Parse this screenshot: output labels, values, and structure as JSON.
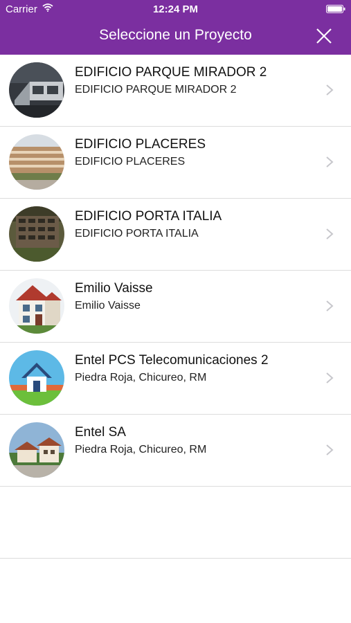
{
  "status_bar": {
    "carrier": "Carrier",
    "time": "12:24 PM"
  },
  "header": {
    "title": "Seleccione un Proyecto"
  },
  "icons": {
    "wifi": "wifi-icon",
    "battery": "battery-icon",
    "close": "close-icon",
    "chevron": "chevron-right-icon"
  },
  "colors": {
    "header_bg": "#7b2fa0",
    "divider": "#dcdcdc",
    "chevron": "#c7c7cc"
  },
  "projects": [
    {
      "title": "EDIFICIO PARQUE MIRADOR 2",
      "subtitle": "EDIFICIO PARQUE MIRADOR 2"
    },
    {
      "title": "EDIFICIO PLACERES",
      "subtitle": "EDIFICIO PLACERES"
    },
    {
      "title": "EDIFICIO PORTA ITALIA",
      "subtitle": "EDIFICIO PORTA ITALIA"
    },
    {
      "title": "Emilio Vaisse",
      "subtitle": "Emilio Vaisse"
    },
    {
      "title": "Entel PCS Telecomunicaciones 2",
      "subtitle": "Piedra Roja, Chicureo, RM"
    },
    {
      "title": "Entel SA",
      "subtitle": "Piedra Roja, Chicureo, RM"
    }
  ]
}
